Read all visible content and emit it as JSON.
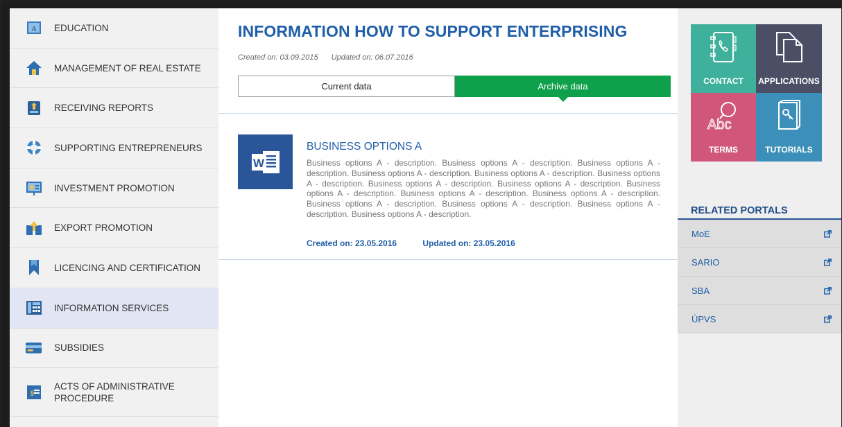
{
  "sidebar": {
    "items": [
      {
        "label": "EDUCATION",
        "icon": "education-icon"
      },
      {
        "label": "MANAGEMENT OF REAL ESTATE",
        "icon": "house-icon"
      },
      {
        "label": "RECEIVING REPORTS",
        "icon": "reports-icon"
      },
      {
        "label": "SUPPORTING ENTREPRENEURS",
        "icon": "lifebuoy-icon"
      },
      {
        "label": "INVESTMENT PROMOTION",
        "icon": "presentation-icon"
      },
      {
        "label": "EXPORT PROMOTION",
        "icon": "export-icon"
      },
      {
        "label": "LICENCING AND CERTIFICATION",
        "icon": "bookmark-icon"
      },
      {
        "label": "INFORMATION SERVICES",
        "icon": "calculator-phone-icon",
        "active": true
      },
      {
        "label": "SUBSIDIES",
        "icon": "card-icon"
      },
      {
        "label": "ACTS OF ADMINISTRATIVE PROCEDURE",
        "icon": "document-sign-icon"
      }
    ]
  },
  "main": {
    "title": "INFORMATION HOW TO SUPPORT ENTERPRISING",
    "created": "Created on: 03.09.2015",
    "updated": "Updated on: 06.07.2016",
    "tabs": {
      "current": "Current data",
      "archive": "Archive data",
      "selected": "archive"
    },
    "document": {
      "icon": "word-document-icon",
      "title": "BUSINESS OPTIONS A",
      "description": "Business options A - description. Business options A - description. Business options A - description. Business options A - description. Business options A - description. Business options A - description. Business options A - description. Business options A - description. Business options A - description. Business options A - description. Business options A - description. Business options A - description. Business options A - description. Business options A - description. Business options A - description.",
      "created": "Created on: 23.05.2016",
      "updated": "Updated on: 23.05.2016"
    }
  },
  "right": {
    "tiles": {
      "contact": {
        "label": "CONTACT",
        "color": "#3fb09b"
      },
      "applications": {
        "label": "APPLICATIONS",
        "color": "#4b4f66"
      },
      "terms": {
        "label": "TERMS",
        "color": "#d0567a"
      },
      "tutorials": {
        "label": "TUTORIALS",
        "color": "#3b8fb8"
      }
    },
    "related_title": "RELATED PORTALS",
    "related": [
      {
        "label": "MoE"
      },
      {
        "label": "SARIO"
      },
      {
        "label": "SBA"
      },
      {
        "label": "ÚPVS"
      }
    ]
  },
  "colors": {
    "accent_blue": "#1f5ea8",
    "accent_green": "#0ea04a",
    "word_blue": "#2a5699"
  }
}
